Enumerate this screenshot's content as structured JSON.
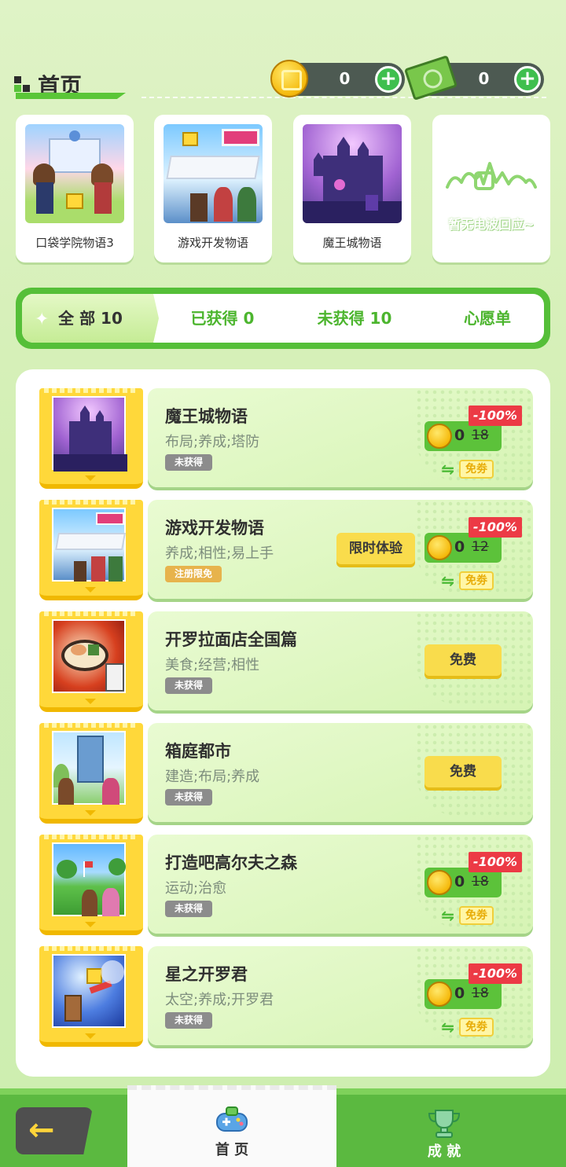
{
  "header": {
    "title": "首页",
    "coins": "0",
    "cash": "0",
    "plus_symbol": "+"
  },
  "recent": [
    {
      "name": "口袋学院物语3",
      "icon": "school-cover"
    },
    {
      "name": "游戏开发物语",
      "icon": "devstory-cover"
    },
    {
      "name": "魔王城物语",
      "icon": "castle-cover"
    },
    {
      "name": "暂无电波回应~",
      "icon": "empty-signal"
    }
  ],
  "tabs": [
    {
      "label": "全 部 10",
      "active": true
    },
    {
      "label": "已获得  0",
      "active": false
    },
    {
      "label": "未获得  10",
      "active": false
    },
    {
      "label": "心愿单",
      "active": false
    }
  ],
  "games": [
    {
      "name": "魔王城物语",
      "tags": "布局;养成;塔防",
      "badge": "未获得",
      "price_now": "0",
      "price_old": "18",
      "discount": "-100%",
      "ticket": "免劵",
      "swap": "⇋"
    },
    {
      "name": "游戏开发物语",
      "tags": "养成;相性;易上手",
      "badge": "注册限免",
      "trial": "限时体验",
      "price_now": "0",
      "price_old": "12",
      "discount": "-100%",
      "ticket": "免劵",
      "swap": "⇋"
    },
    {
      "name": "开罗拉面店全国篇",
      "tags": "美食;经营;相性",
      "badge": "未获得",
      "free": "免费"
    },
    {
      "name": "箱庭都市",
      "tags": "建造;布局;养成",
      "badge": "未获得",
      "free": "免费"
    },
    {
      "name": "打造吧高尔夫之森",
      "tags": "运动;治愈",
      "badge": "未获得",
      "price_now": "0",
      "price_old": "18",
      "discount": "-100%",
      "ticket": "免劵",
      "swap": "⇋"
    },
    {
      "name": "星之开罗君",
      "tags": "太空;养成;开罗君",
      "badge": "未获得",
      "price_now": "0",
      "price_old": "18",
      "discount": "-100%",
      "ticket": "免劵",
      "swap": "⇋"
    }
  ],
  "bottom_nav": {
    "back_symbol": "←",
    "home_label": "首 页",
    "achievements_label": "成 就"
  },
  "colors": {
    "accent_green": "#55bf38",
    "coin_gold": "#f5b90b",
    "discount_red": "#ec3a45",
    "button_yellow": "#f9dc4c"
  }
}
